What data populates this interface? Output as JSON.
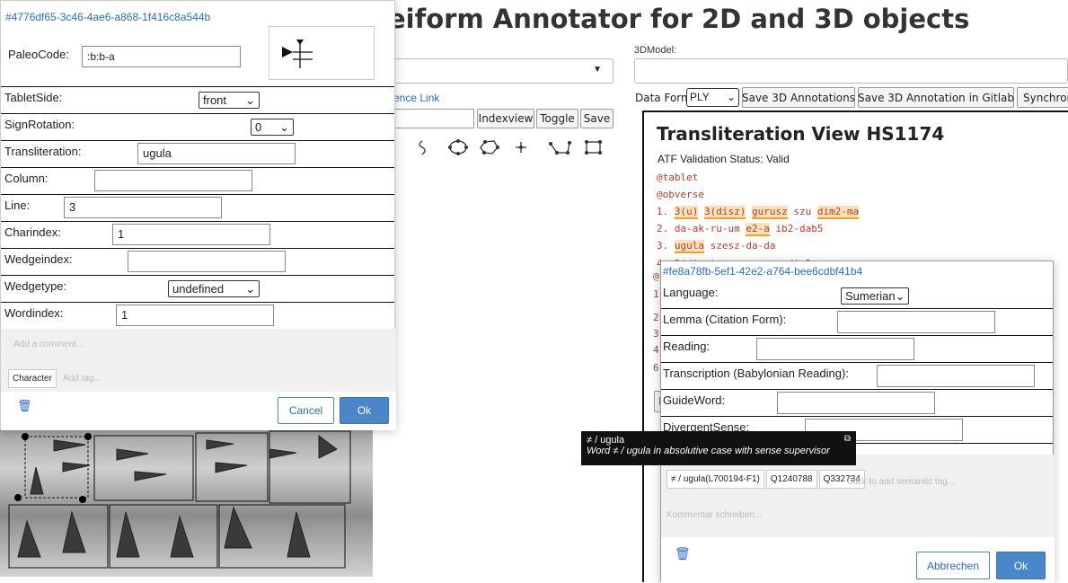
{
  "page": {
    "title": "eiform Annotator for 2D and 3D objects",
    "model_label": "3DModel:",
    "reference_link": "ence Link",
    "buttons": {
      "indexview": "Indexview",
      "toggle": "Toggle",
      "save": "Save"
    },
    "data_format_label": "Data Format:",
    "data_format_value": "PLY",
    "save_3d": "Save 3D Annotations",
    "save_gitlab": "Save 3D Annotation in Gitlab",
    "synchron": "Synchron"
  },
  "tools": [
    "lasso-icon",
    "ellipse-icon",
    "polygon-icon",
    "point-icon",
    "polyline-icon",
    "rectangle-icon"
  ],
  "transliteration": {
    "title": "Transliteration View HS1174",
    "status": "ATF Validation Status: Valid",
    "tablet": "@tablet",
    "obverse": "@obverse",
    "lines": [
      {
        "num": "1.",
        "tokens": [
          [
            "3(u)",
            "hl"
          ],
          [
            " ",
            ""
          ],
          [
            "3(disz)",
            "hl"
          ],
          [
            " ",
            ""
          ],
          [
            "gurusz",
            "hl"
          ],
          [
            " szu ",
            ""
          ],
          [
            "dim2-ma",
            "hl"
          ]
        ]
      },
      {
        "num": "2.",
        "tokens": [
          [
            "da-ak-ru-um ",
            ""
          ],
          [
            "e2-a",
            "hl"
          ],
          [
            " ib2-dab5",
            ""
          ]
        ]
      },
      {
        "num": "3.",
        "tokens": [
          [
            "ugula",
            "hl"
          ],
          [
            " szesz-da-da",
            ""
          ]
        ]
      }
    ],
    "line4_num": "4.",
    "partial_line": "3(disz) gurusz szu dim2-ma",
    "side_marks": [
      "@r",
      "1",
      "2",
      "3",
      "4",
      "6"
    ],
    "left_button": "I"
  },
  "sign_dialog": {
    "id": "#4776df65-3c46-4ae6-a868-1f416c8a544b",
    "paleocode_label": "PaleoCode:",
    "paleocode_value": ":b:b-a",
    "fields": [
      {
        "label": "TabletSide:",
        "kind": "select",
        "value": "front"
      },
      {
        "label": "SignRotation:",
        "kind": "select",
        "value": "0"
      },
      {
        "label": "Transliteration:",
        "kind": "text",
        "value": "ugula"
      },
      {
        "label": "Column:",
        "kind": "text",
        "value": ""
      },
      {
        "label": "Line:",
        "kind": "text",
        "value": "3"
      },
      {
        "label": "Charindex:",
        "kind": "text",
        "value": "1"
      },
      {
        "label": "Wedgeindex:",
        "kind": "text",
        "value": ""
      },
      {
        "label": "Wedgetype:",
        "kind": "select",
        "value": "undefined"
      },
      {
        "label": "Wordindex:",
        "kind": "text",
        "value": "1"
      }
    ],
    "comment_placeholder": "Add a comment...",
    "tag": "Character",
    "tag_placeholder": "Add tag...",
    "cancel": "Cancel",
    "ok": "Ok"
  },
  "word_dialog": {
    "id": "#fe8a78fb-5ef1-42e2-a764-bee6cdbf41b4",
    "fields": [
      {
        "label": "Language:",
        "kind": "select",
        "value": "Sumerian"
      },
      {
        "label": "Lemma (Citation Form):",
        "kind": "text",
        "value": ""
      },
      {
        "label": "Reading:",
        "kind": "text",
        "value": ""
      },
      {
        "label": "Transcription (Babylonian Reading):",
        "kind": "text",
        "value": ""
      },
      {
        "label": "GuideWord:",
        "kind": "text",
        "value": ""
      },
      {
        "label": "DivergentSense:",
        "kind": "text",
        "value": ""
      }
    ],
    "tags": [
      "≠ / ugula(L700194-F1)",
      "Q1240788",
      "Q332734"
    ],
    "tag_placeholder": "Click to add semantic tag...",
    "comment_placeholder": "Kommentar schreiben...",
    "cancel": "Abbrechen",
    "ok": "Ok"
  },
  "tooltip": {
    "title": "≠ / ugula",
    "desc": "Word ≠ / ugula in absolutive case with sense supervisor"
  }
}
